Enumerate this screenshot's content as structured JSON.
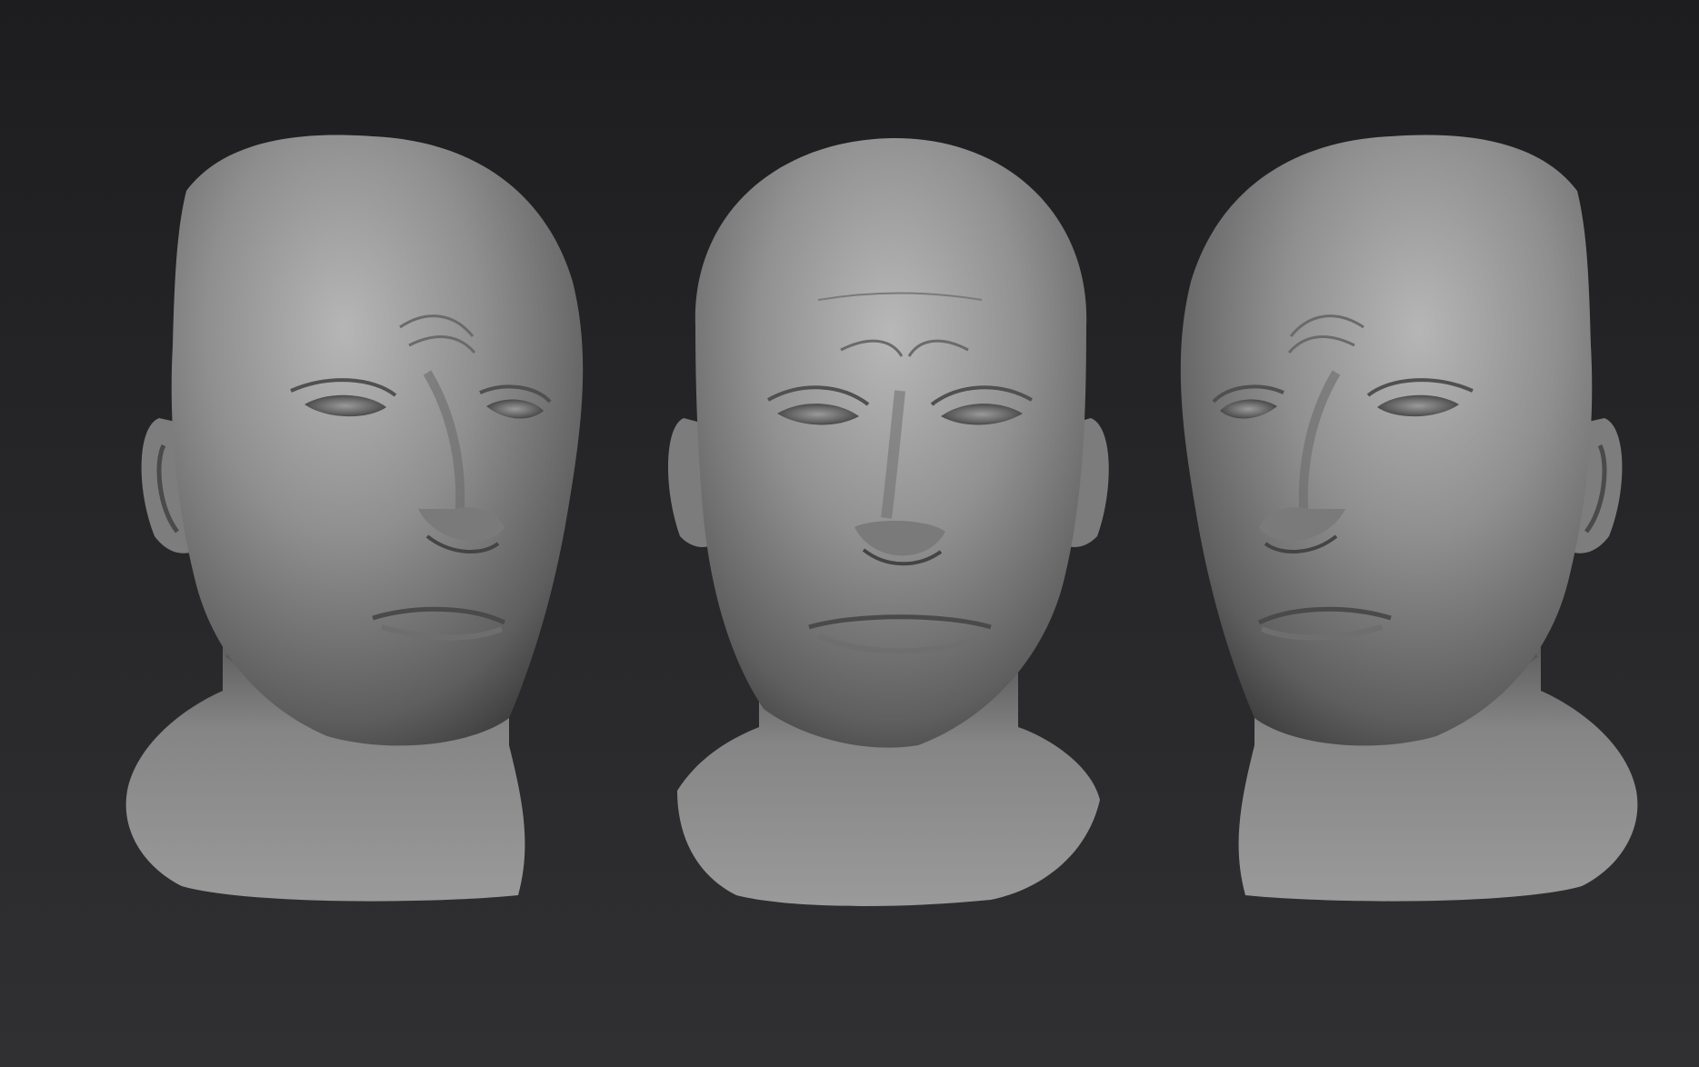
{
  "scene": {
    "background_top": "#1d1d1f",
    "background_bottom": "#303032",
    "material_color": "#8a8a8a",
    "material_highlight": "#b4b4b4",
    "material_shadow": "#3a3a3a"
  },
  "heads": [
    {
      "view": "three-quarter-left"
    },
    {
      "view": "front"
    },
    {
      "view": "three-quarter-right"
    }
  ]
}
